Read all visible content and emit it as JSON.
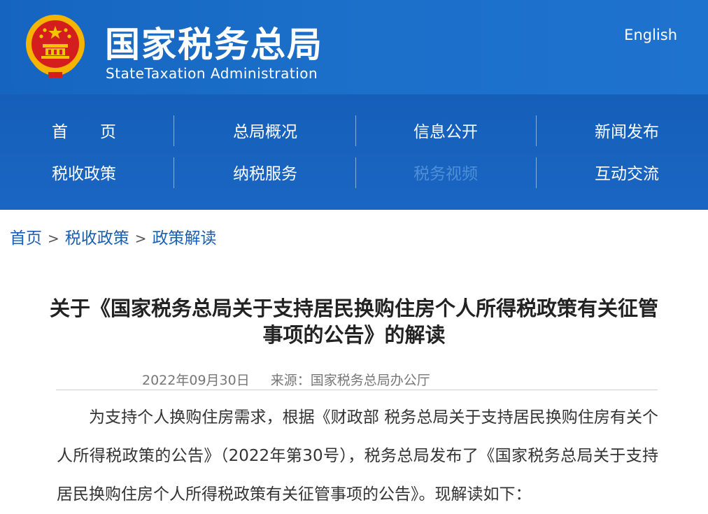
{
  "header": {
    "site_name_cn": "国家税务总局",
    "site_name_en": "StateTaxation Administration",
    "language_link": "English",
    "emblem_icon": "national-emblem-icon"
  },
  "nav": {
    "items": [
      {
        "label": "首　　页"
      },
      {
        "label": "总局概况"
      },
      {
        "label": "信息公开"
      },
      {
        "label": "新闻发布"
      },
      {
        "label": "税收政策"
      },
      {
        "label": "纳税服务"
      },
      {
        "label": "税务视频"
      },
      {
        "label": "互动交流"
      }
    ]
  },
  "breadcrumb": {
    "items": [
      "首页",
      "税收政策",
      "政策解读"
    ],
    "separator": ">"
  },
  "article": {
    "title": "关于《国家税务总局关于支持居民换购住房个人所得税政策有关征管事项的公告》的解读",
    "date": "2022年09月30日",
    "source_label": "来源：",
    "source": "国家税务总局办公厅",
    "paragraph": "为支持个人换购住房需求，根据《财政部 税务总局关于支持居民换购住房有关个人所得税政策的公告》（2022年第30号），税务总局发布了《国家税务总局关于支持居民换购住房个人所得税政策有关征管事项的公告》。现解读如下："
  },
  "colors": {
    "header_blue": "#1565c0",
    "link_blue": "#1a5fb4",
    "emblem_gold": "#f5b400",
    "emblem_red": "#d41e1e"
  }
}
